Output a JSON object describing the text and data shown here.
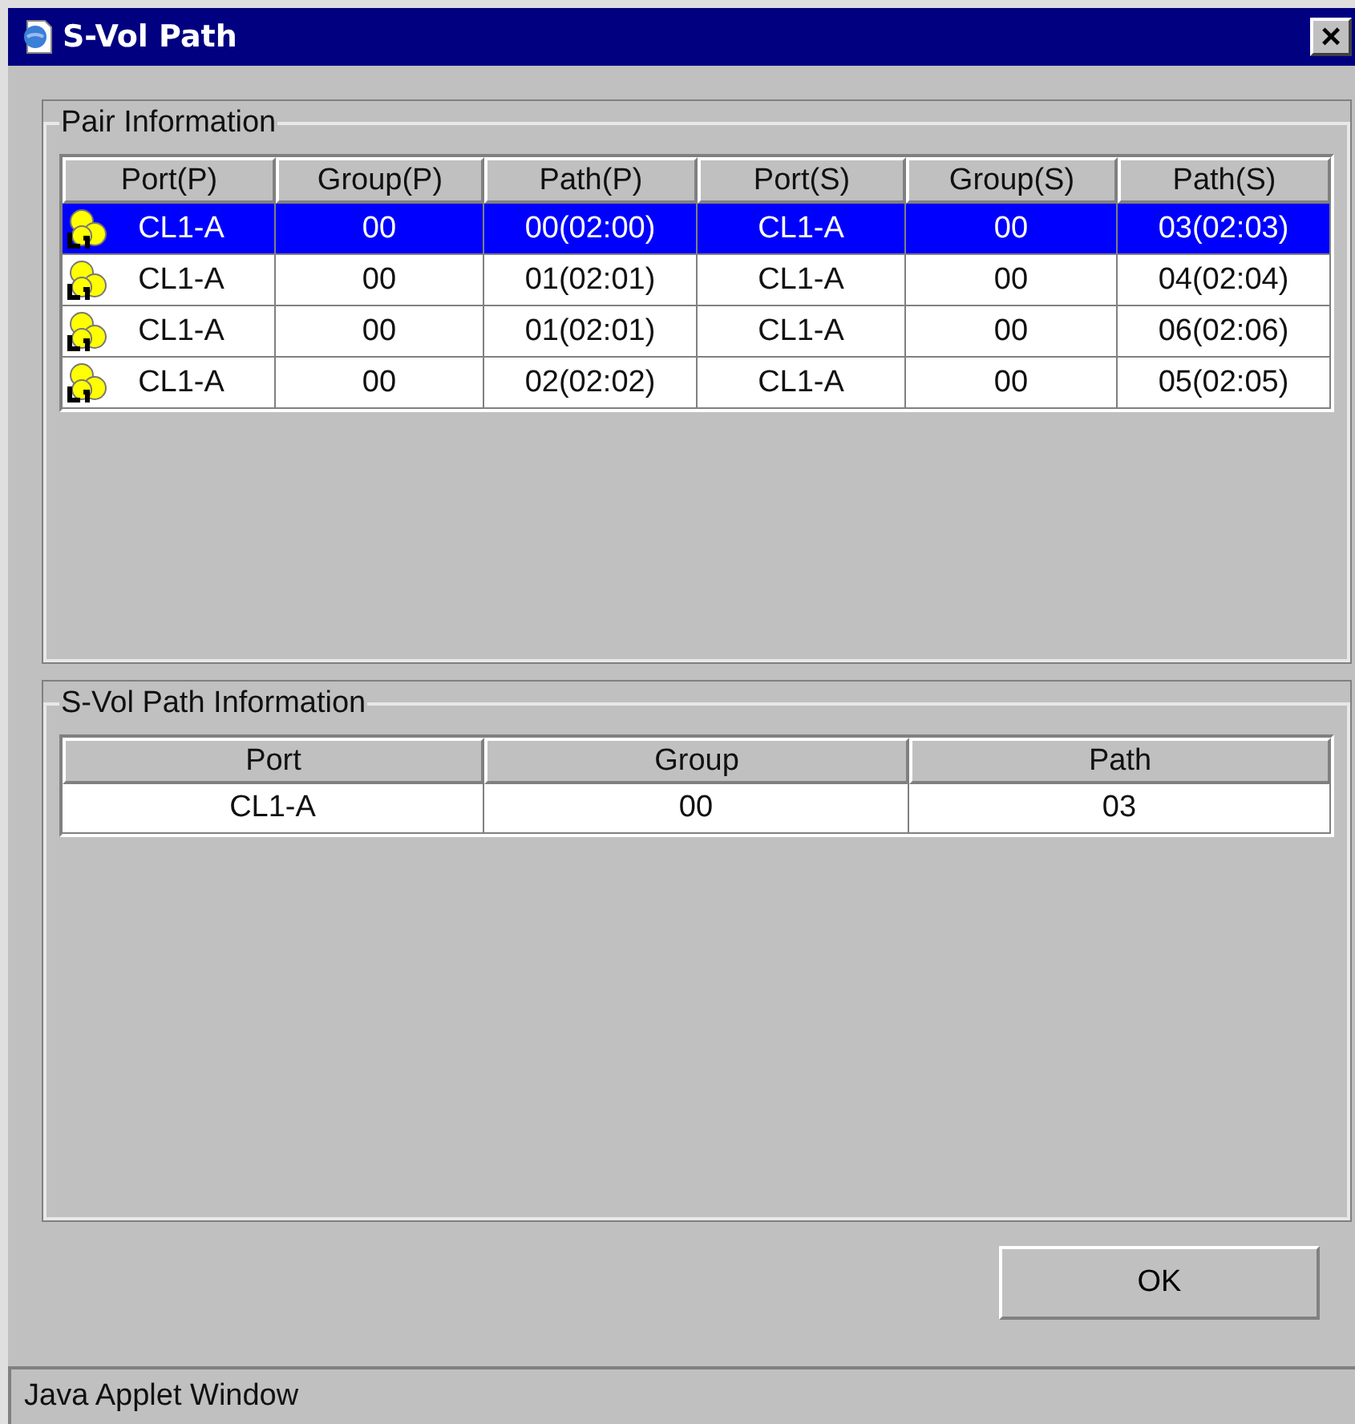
{
  "window": {
    "title": "S-Vol Path",
    "close": "×"
  },
  "pair_information": {
    "title": "Pair Information",
    "columns": [
      "Port(P)",
      "Group(P)",
      "Path(P)",
      "Port(S)",
      "Group(S)",
      "Path(S)"
    ],
    "rows": [
      {
        "selected": true,
        "cells": [
          "CL1-A",
          "00",
          "00(02:00)",
          "CL1-A",
          "00",
          "03(02:03)"
        ]
      },
      {
        "selected": false,
        "cells": [
          "CL1-A",
          "00",
          "01(02:01)",
          "CL1-A",
          "00",
          "04(02:04)"
        ]
      },
      {
        "selected": false,
        "cells": [
          "CL1-A",
          "00",
          "01(02:01)",
          "CL1-A",
          "00",
          "06(02:06)"
        ]
      },
      {
        "selected": false,
        "cells": [
          "CL1-A",
          "00",
          "02(02:02)",
          "CL1-A",
          "00",
          "05(02:05)"
        ]
      }
    ]
  },
  "svol_path_information": {
    "title": "S-Vol Path Information",
    "columns": [
      "Port",
      "Group",
      "Path"
    ],
    "rows": [
      {
        "cells": [
          "CL1-A",
          "00",
          "03"
        ]
      }
    ]
  },
  "buttons": [
    "OK"
  ],
  "status_bar": "Java Applet Window"
}
